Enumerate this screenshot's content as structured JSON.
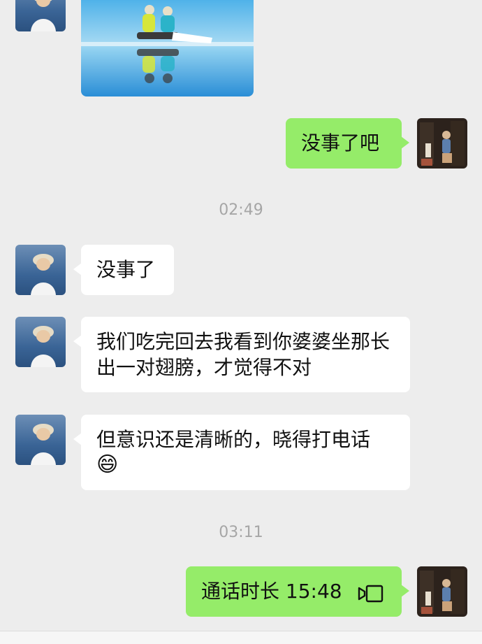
{
  "messages": {
    "m1_text": "没事了吧",
    "ts1": "02:49",
    "m2_text": "没事了",
    "m3_text": "我们吃完回去我看到你婆婆坐那长出一对翅膀，才觉得不对",
    "m4_text": "但意识还是清晰的，晓得打电话",
    "m4_emoji": "😄",
    "ts2": "03:11",
    "call_label": "通话时长 15:48",
    "call_icon": "video-call-icon"
  },
  "colors": {
    "background": "#ededed",
    "incoming_bubble": "#ffffff",
    "outgoing_bubble": "#95ec69",
    "timestamp": "#a6a6a6"
  }
}
